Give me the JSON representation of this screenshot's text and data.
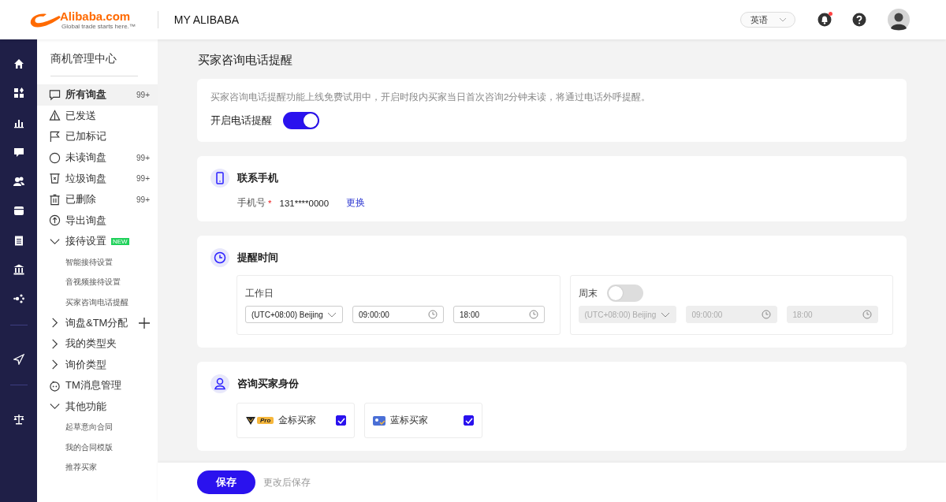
{
  "header": {
    "logo": {
      "wordmark": "Alibaba.com",
      "tagline": "Global trade starts here.™"
    },
    "title": "MY ALIBABA",
    "language": "英语",
    "has_unread": true
  },
  "sidebar": {
    "title": "商机管理中心",
    "items": [
      {
        "kind": "entry",
        "label": "所有询盘",
        "count": "99+",
        "selected": true
      },
      {
        "kind": "entry",
        "label": "已发送",
        "selected": false
      },
      {
        "kind": "entry",
        "label": "已加标记",
        "selected": false
      },
      {
        "kind": "entry",
        "label": "未读询盘",
        "count": "99+",
        "selected": false
      },
      {
        "kind": "entry",
        "label": "垃圾询盘",
        "count": "99+",
        "selected": false
      },
      {
        "kind": "entry",
        "label": "已删除",
        "count": "99+",
        "selected": false
      },
      {
        "kind": "entry",
        "label": "导出询盘",
        "selected": false
      },
      {
        "kind": "group",
        "label": "接待设置",
        "badge": "NEW",
        "expanded": true,
        "children": [
          {
            "label": "智能接待设置"
          },
          {
            "label": "音视频接待设置"
          },
          {
            "label": "买家咨询电话提醒"
          }
        ]
      },
      {
        "kind": "group",
        "label": "询盘&TM分配",
        "expanded": false,
        "addable": true
      },
      {
        "kind": "group",
        "label": "我的类型夹",
        "expanded": false
      },
      {
        "kind": "group",
        "label": "询价类型",
        "expanded": false
      },
      {
        "kind": "entry",
        "label": "TM消息管理",
        "selected": false
      },
      {
        "kind": "group",
        "label": "其他功能",
        "expanded": true,
        "children": [
          {
            "label": "起草意向合同"
          },
          {
            "label": "我的合同模版"
          },
          {
            "label": "推荐买家"
          }
        ]
      }
    ]
  },
  "page_title": "买家咨询电话提醒",
  "notice": {
    "text": "买家咨询电话提醒功能上线免费试用中，开启时段内买家当日首次咨询2分钟未读，将通过电话外呼提醒。",
    "switch_label": "开启电话提醒",
    "on": true
  },
  "contact": {
    "title": "联系手机",
    "field_label": "手机号",
    "required": true,
    "required_mark": "*",
    "value": "131****0000",
    "link": "更换"
  },
  "schedule": {
    "title": "提醒时间",
    "panels": [
      {
        "label": "工作日",
        "disabled": false,
        "timezone": "(UTC+08:00) Beijing",
        "start": "09:00:00",
        "end": "18:00"
      },
      {
        "label": "周末",
        "on": false,
        "disabled": true,
        "timezone": "(UTC+08:00) Beijing",
        "start": "09:00:00",
        "end": "18:00"
      }
    ]
  },
  "identity": {
    "title": "咨询买家身份",
    "options": [
      {
        "label": "金标买家",
        "badge": "Pro",
        "checked": true
      },
      {
        "label": "蓝标买家",
        "checked": true
      }
    ]
  },
  "footer": {
    "save": "保存",
    "hint": "更改后保存"
  }
}
